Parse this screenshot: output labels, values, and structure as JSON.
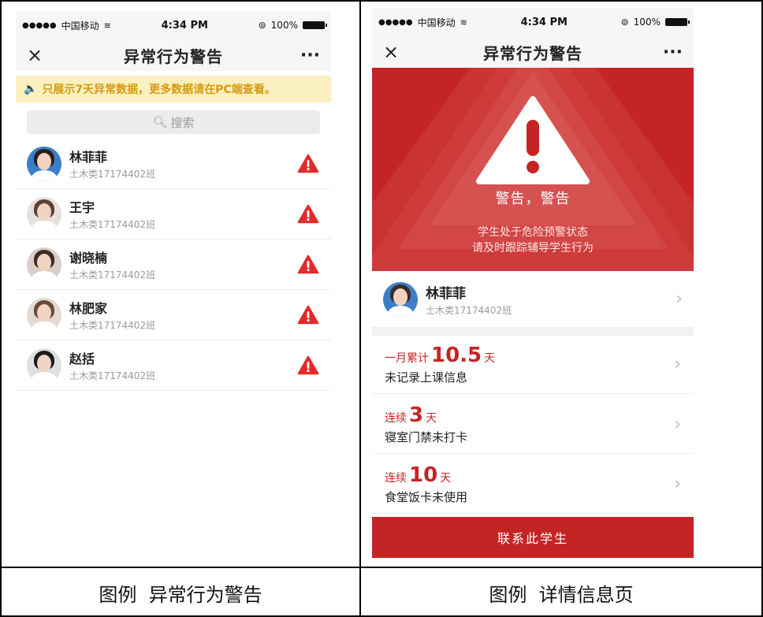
{
  "left_screen": {
    "status": {
      "carrier": "中国移动",
      "time": "4:34 PM",
      "battery": "100%"
    },
    "nav": {
      "close": "×",
      "title": "异常行为警告",
      "more": "···"
    },
    "notice": {
      "icon": "speaker-icon",
      "text": "只展示7天异常数据，更多数据请在PC端查看。"
    },
    "search": {
      "icon": "search-icon",
      "placeholder": "搜索"
    },
    "students": [
      {
        "name": "林菲菲",
        "class": "土木类17174402班"
      },
      {
        "name": "王宇",
        "class": "土木类17174402班"
      },
      {
        "name": "谢晓楠",
        "class": "土木类17174402班"
      },
      {
        "name": "林肥家",
        "class": "土木类17174402班"
      },
      {
        "name": "赵括",
        "class": "土木类17174402班"
      }
    ]
  },
  "right_screen": {
    "status": {
      "carrier": "中国移动",
      "time": "4:34 PM",
      "battery": "100%"
    },
    "nav": {
      "close": "×",
      "title": "异常行为警告",
      "more": "···"
    },
    "hero": {
      "title": "警告，警告",
      "line1": "学生处于危险预警状态",
      "line2": "请及时跟踪辅导学生行为"
    },
    "student": {
      "name": "林菲菲",
      "class": "土木类17174402班"
    },
    "metrics": [
      {
        "prefix": "一月累计",
        "value": "10.5",
        "unit": "天",
        "desc": "未记录上课信息"
      },
      {
        "prefix": "连续",
        "value": "3",
        "unit": "天",
        "desc": "寝室门禁未打卡"
      },
      {
        "prefix": "连续",
        "value": "10",
        "unit": "天",
        "desc": "食堂饭卡未使用"
      }
    ],
    "contact_button": "联系此学生"
  },
  "captions": {
    "left": "图例  异常行为警告",
    "right": "图例  详情信息页"
  },
  "colors": {
    "accent_red": "#c42524",
    "notice_bg": "#fbf0c0",
    "notice_text": "#d79a11"
  }
}
